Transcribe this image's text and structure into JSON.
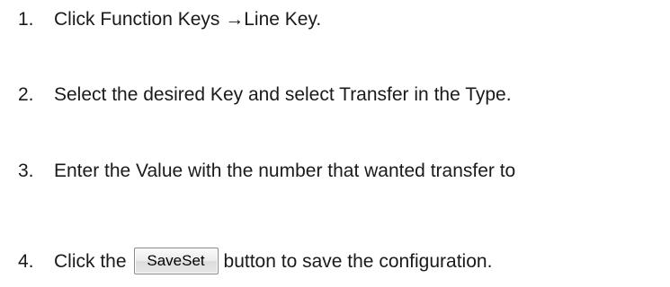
{
  "steps": [
    {
      "number": "1.",
      "text": "Click Function Keys →Line Key."
    },
    {
      "number": "2.",
      "text": "Select the desired Key and select Transfer in the  Type."
    },
    {
      "number": "3.",
      "text": "Enter the Value with the number that wanted transfer  to"
    },
    {
      "number": "4.",
      "text_before": "Click the",
      "button_label": "SaveSet",
      "text_after": "button to save the configuration."
    }
  ]
}
